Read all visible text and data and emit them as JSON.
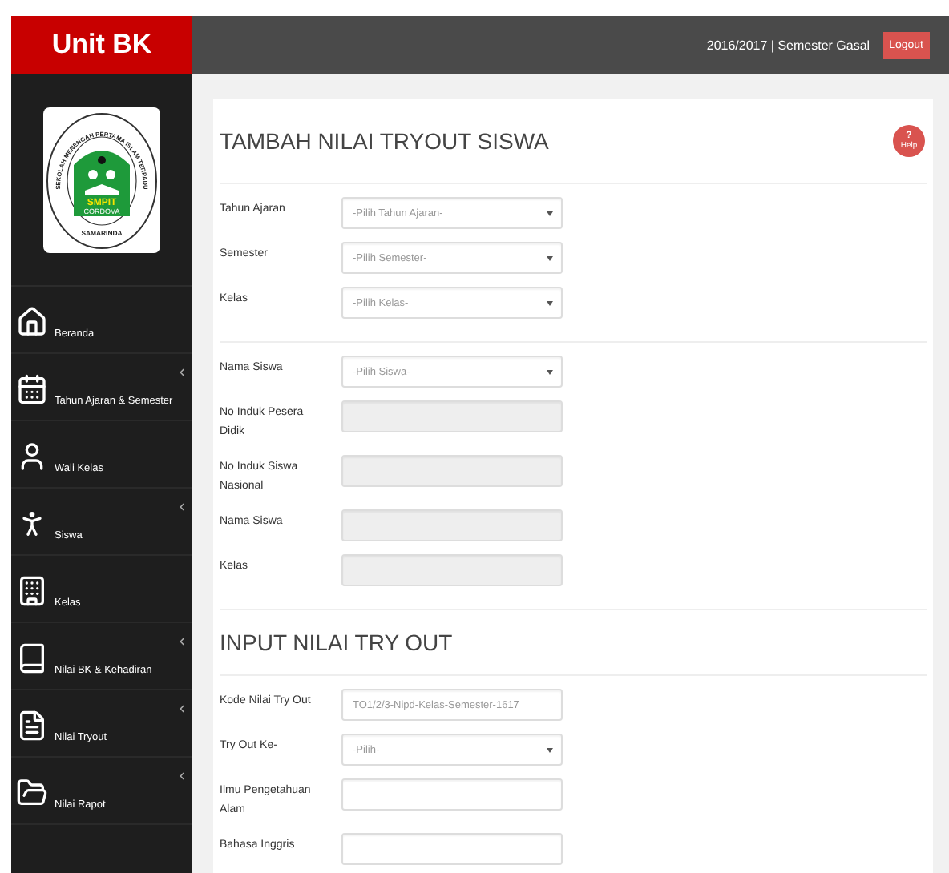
{
  "brand": {
    "title": "Unit BK"
  },
  "topbar": {
    "session": "2016/2017 | Semester Gasal",
    "logout": "Logout"
  },
  "logo": {
    "ring_text": "SEKOLAH MENENGAH PERTAMA ISLAM TERPADU",
    "badge": "SMPIT",
    "subtitle": "CORDOVA",
    "city": "SAMARINDA"
  },
  "sidebar": {
    "items": [
      {
        "label": "Beranda",
        "submenu": false
      },
      {
        "label": "Tahun Ajaran & Semester",
        "submenu": true
      },
      {
        "label": "Wali Kelas",
        "submenu": false
      },
      {
        "label": "Siswa",
        "submenu": true
      },
      {
        "label": "Kelas",
        "submenu": false
      },
      {
        "label": "Nilai BK & Kehadiran",
        "submenu": true
      },
      {
        "label": "Nilai Tryout",
        "submenu": true
      },
      {
        "label": "Nilai Rapot",
        "submenu": true
      }
    ]
  },
  "help": {
    "mark": "?",
    "label": "Help"
  },
  "sections": [
    {
      "title": "TAMBAH NILAI TRYOUT SISWA",
      "groups": [
        [
          {
            "label": "Tahun Ajaran",
            "kind": "select",
            "placeholder": "-Pilih Tahun Ajaran-"
          },
          {
            "label": "Semester",
            "kind": "select",
            "placeholder": "-Pilih Semester-"
          },
          {
            "label": "Kelas",
            "kind": "select",
            "placeholder": "-Pilih Kelas-"
          }
        ],
        [
          {
            "label": "Nama Siswa",
            "kind": "select",
            "placeholder": "-Pilih Siswa-"
          },
          {
            "label": "No Induk Pesera Didik",
            "kind": "disabled"
          },
          {
            "label": "No Induk Siswa Nasional",
            "kind": "disabled"
          },
          {
            "label": "Nama Siswa",
            "kind": "disabled"
          },
          {
            "label": "Kelas",
            "kind": "disabled"
          }
        ]
      ]
    },
    {
      "title": "INPUT NILAI TRY OUT",
      "groups": [
        [
          {
            "label": "Kode Nilai Try Out",
            "kind": "text",
            "placeholder": "TO1/2/3-Nipd-Kelas-Semester-1617"
          },
          {
            "label": "Try Out Ke-",
            "kind": "select",
            "placeholder": "-Pilih-"
          },
          {
            "label": "Ilmu Pengetahuan Alam",
            "kind": "text"
          },
          {
            "label": "Bahasa Inggris",
            "kind": "text"
          }
        ]
      ]
    }
  ]
}
